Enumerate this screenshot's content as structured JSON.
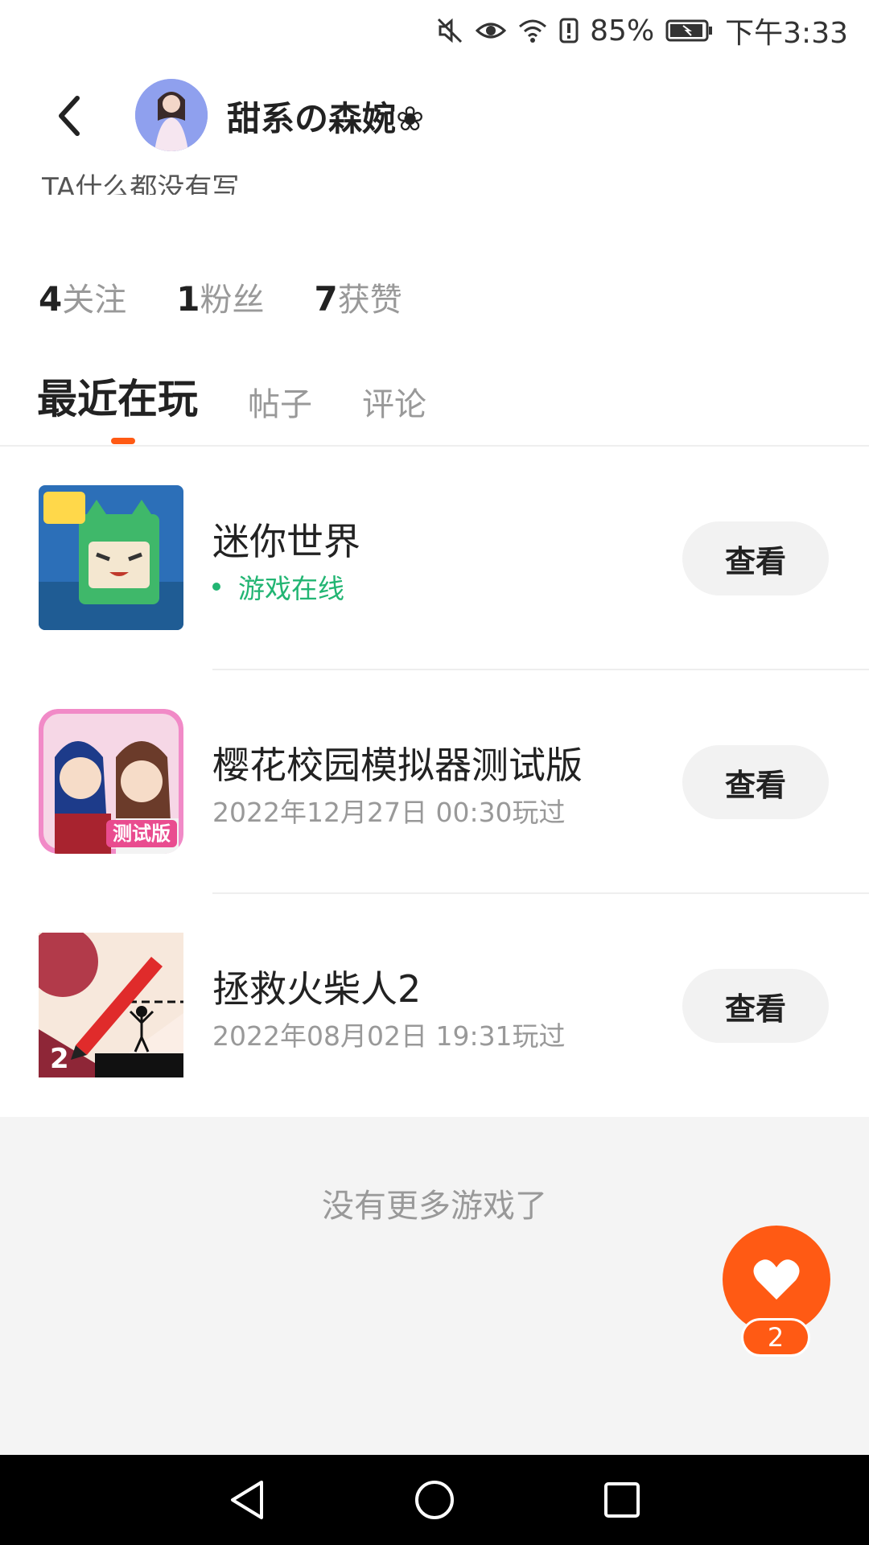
{
  "status_bar": {
    "battery_percent": "85%",
    "time": "下午3:33",
    "icons": [
      "mute-icon",
      "eye-icon",
      "wifi-icon",
      "alert-icon",
      "battery-icon"
    ]
  },
  "header": {
    "back_icon": "back-arrow-icon",
    "user_name": "甜系の森婉❀",
    "bio": "TA什么都没有写"
  },
  "stats": [
    {
      "num": "4",
      "label": "关注"
    },
    {
      "num": "1",
      "label": "粉丝"
    },
    {
      "num": "7",
      "label": "获赞"
    }
  ],
  "tabs": [
    {
      "label": "最近在玩",
      "active": true
    },
    {
      "label": "帖子",
      "active": false
    },
    {
      "label": "评论",
      "active": false
    }
  ],
  "games": [
    {
      "title": "迷你世界",
      "sub": "游戏在线",
      "online": true,
      "button": "查看"
    },
    {
      "title": "樱花校园模拟器测试版",
      "sub": "2022年12月27日 00:30玩过",
      "online": false,
      "button": "查看"
    },
    {
      "title": "拯救火柴人2",
      "sub": "2022年08月02日 19:31玩过",
      "online": false,
      "button": "查看"
    }
  ],
  "footer": {
    "no_more_text": "没有更多游戏了"
  },
  "fab": {
    "icon": "heart-icon",
    "badge": "2"
  },
  "nav_bar": {
    "icons": [
      "nav-back-icon",
      "nav-home-icon",
      "nav-recents-icon"
    ]
  },
  "colors": {
    "accent": "#ff5a14",
    "online": "#22b573"
  }
}
